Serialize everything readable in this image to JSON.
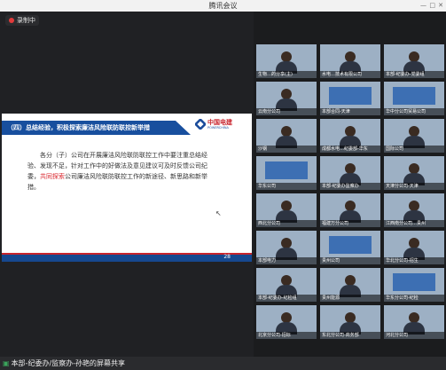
{
  "window": {
    "title": "腾讯会议"
  },
  "recording": {
    "label": "录制中"
  },
  "slide": {
    "header": "（四）总结经验，积极探索廉洁风险联防联控新举措",
    "logo_cn": "中国电建",
    "logo_en": "POWERCHINA",
    "body_part1": "各分（子）公司在开展廉洁风险联防联控工作中要注重总结经验、发现不足，针对工作中的好做法及意见建议可及时反馈公司纪委，",
    "body_red": "共同探索",
    "body_part2": "公司廉洁风险联防联控工作的新途径、新思路和新举措。",
    "page_indicator": "28"
  },
  "participants": [
    "生物…的分享(主)",
    "水电…技术有限公司",
    "本部-纪委办-党委组",
    "云南分公司",
    "本部合同-天津",
    "华中分公司贸易公司",
    "沙钢",
    "成都水电…纪委部-华东",
    "国际公司",
    "华东公司",
    "本部-纪委办监察办",
    "天津分公司-天津",
    "西北分公司",
    "福建万分公司",
    "江西南分公司…贵州",
    "本部电力",
    "贵州公司",
    "华北分公司-招生",
    "本部-纪委办-纪检组",
    "贵州能源",
    "华东分公司-纪检",
    "北京分公司-招标",
    "东北分公司-商务部",
    "河北分公司",
    "云南分公司-纪委办监察",
    "本部",
    "内蒙古分公司事"
  ],
  "bottom": {
    "share_label": "本部-纪委办/监察办-孙艳的屏幕共享"
  }
}
